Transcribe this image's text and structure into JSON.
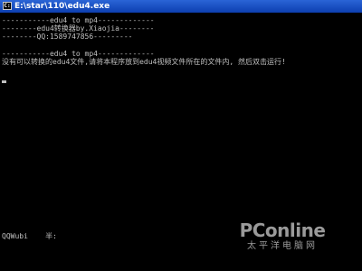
{
  "window": {
    "title": "E:\\star\\110\\edu4.exe",
    "icon": "cmd-icon"
  },
  "console": {
    "lines": [
      "-----------edu4 to mp4-------------",
      "--------edu4转换器by.Xiaojia--------",
      "--------QQ:1589747856---------",
      "",
      "-----------edu4 to mp4-------------",
      "没有可以转换的edu4文件,请将本程序放到edu4视频文件所在的文件内, 然后双击运行!"
    ],
    "status_line": "QQWubi    半:"
  },
  "watermark": {
    "brand": "PConline",
    "sub": "太平洋电脑网"
  }
}
